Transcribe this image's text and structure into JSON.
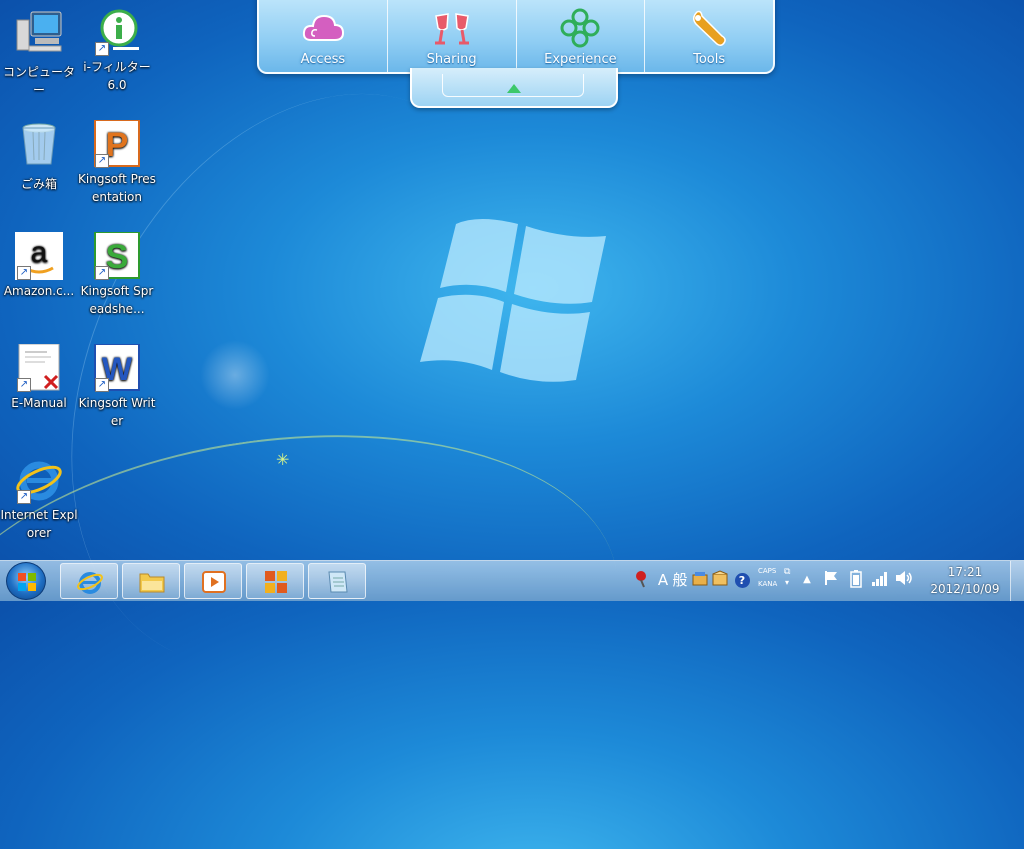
{
  "desktop": {
    "icons": [
      {
        "label": "コンピューター"
      },
      {
        "label": "i-フィルター6.0"
      },
      {
        "label": "ごみ箱"
      },
      {
        "label": "Kingsoft Presentation"
      },
      {
        "label": "Amazon.c..."
      },
      {
        "label": "Kingsoft Spreadshe..."
      },
      {
        "label": "E-Manual"
      },
      {
        "label": "Kingsoft Writer"
      },
      {
        "label": "Internet Explorer"
      }
    ]
  },
  "launcher": {
    "items": [
      {
        "label": "Access",
        "icon": "cloud-icon"
      },
      {
        "label": "Sharing",
        "icon": "glasses-toast-icon"
      },
      {
        "label": "Experience",
        "icon": "clover-icon"
      },
      {
        "label": "Tools",
        "icon": "wrench-icon"
      }
    ]
  },
  "taskbar": {
    "pinned": [
      "internet-explorer-icon",
      "file-explorer-icon",
      "media-player-icon",
      "office-icon",
      "notepad-icon"
    ],
    "tray": {
      "ime_mode": "A",
      "ime_kanji": "般",
      "caps": "CAPS",
      "kana": "KANA",
      "help": "?"
    },
    "clock": {
      "time": "17:21",
      "date": "2012/10/09"
    }
  },
  "colors": {
    "accent": "#1d8ad8",
    "taskbar": "#8ab8df",
    "launcher_green": "#3cc86b"
  }
}
